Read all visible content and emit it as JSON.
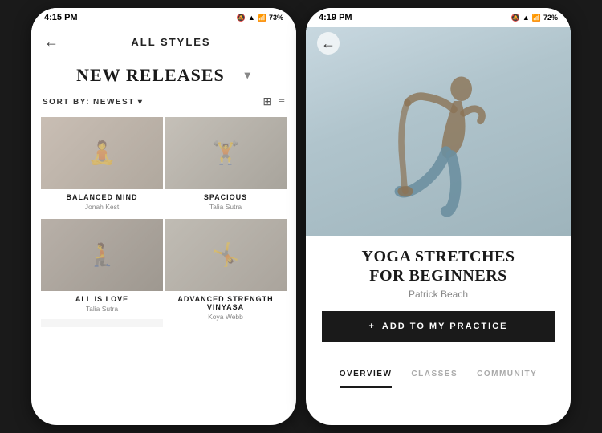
{
  "left_phone": {
    "status_bar": {
      "time": "4:15 PM",
      "battery": "73%",
      "signal": "📶"
    },
    "nav": {
      "back_label": "←",
      "title": "ALL STYLES"
    },
    "section": {
      "title": "NEW RELEASES",
      "dropdown_char": "▾"
    },
    "sort": {
      "label": "SORT BY:",
      "value": "NEWEST",
      "arrow": "▾"
    },
    "cards": [
      {
        "id": "card-1",
        "title": "BALANCED MIND",
        "subtitle": "Jonah Kest",
        "img_class": "img1"
      },
      {
        "id": "card-2",
        "title": "SPACIOUS",
        "subtitle": "Talia Sutra",
        "img_class": "img2"
      },
      {
        "id": "card-3",
        "title": "ALL IS LOVE",
        "subtitle": "Talia Sutra",
        "img_class": "img3"
      },
      {
        "id": "card-4",
        "title": "ADVANCED STRENGTH VINYASA",
        "subtitle": "Koya Webb",
        "img_class": "img4"
      },
      {
        "id": "card-5",
        "title": "",
        "subtitle": "",
        "img_class": "img5"
      },
      {
        "id": "card-6",
        "title": "",
        "subtitle": "",
        "img_class": "img6"
      }
    ]
  },
  "right_phone": {
    "status_bar": {
      "time": "4:19 PM",
      "battery": "72%"
    },
    "nav": {
      "back_label": "←"
    },
    "hero": {
      "title": "YOGA STRETCHES\nFOR BEGINNERS",
      "instructor": "Patrick Beach"
    },
    "add_button": {
      "prefix": "+",
      "label": "ADD TO MY PRACTICE"
    },
    "tabs": [
      {
        "id": "tab-overview",
        "label": "OVERVIEW",
        "active": true
      },
      {
        "id": "tab-classes",
        "label": "CLASSES",
        "active": false
      },
      {
        "id": "tab-community",
        "label": "COMMUNITY",
        "active": false
      }
    ]
  }
}
